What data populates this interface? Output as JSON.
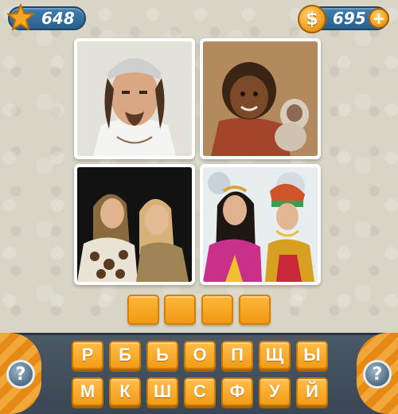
{
  "header": {
    "score": "648",
    "coins": "695",
    "coin_symbol": "$",
    "plus_symbol": "+",
    "star_icon": "star-icon",
    "coin_icon": "dollar-coin-icon",
    "plus_icon": "plus-icon"
  },
  "photos": [
    {
      "subject": "man-with-bandana-portrait"
    },
    {
      "subject": "girl-with-monkey"
    },
    {
      "subject": "two-women-at-party"
    },
    {
      "subject": "two-women-in-gypsy-costumes"
    }
  ],
  "answer": {
    "slots": [
      "",
      "",
      "",
      ""
    ]
  },
  "keyboard": {
    "row1": [
      "Р",
      "Б",
      "Ь",
      "О",
      "П",
      "Щ",
      "Ы"
    ],
    "row2": [
      "М",
      "К",
      "Ш",
      "С",
      "Ф",
      "У",
      "Й"
    ]
  },
  "help": {
    "left_label": "?",
    "right_label": "?"
  },
  "colors": {
    "accent_orange": "#f29c16",
    "pill_blue": "#2b5f8c",
    "panel_dark": "#3a4653"
  }
}
